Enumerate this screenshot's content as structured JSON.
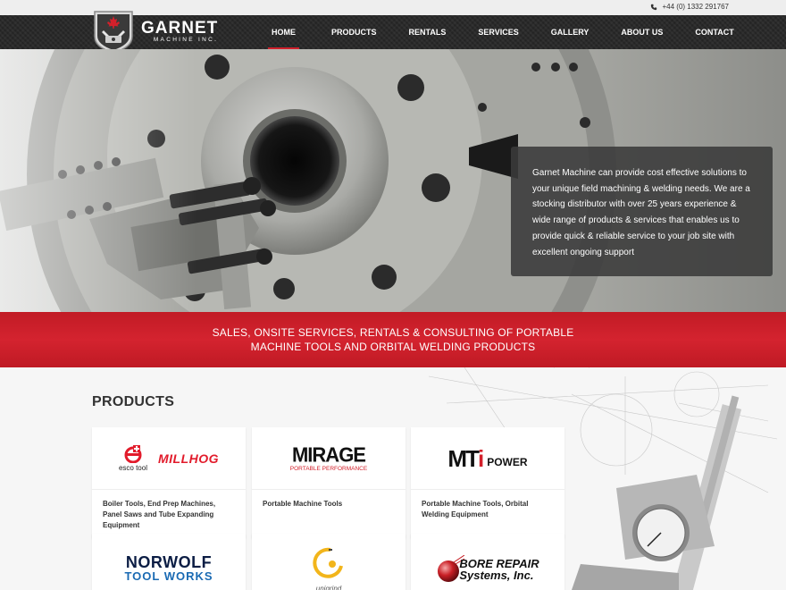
{
  "topbar": {
    "phone": "+44 (0) 1332 291767",
    "phone_icon": "phone-icon"
  },
  "brand": {
    "name": "GARNET",
    "sub": "MACHINE INC."
  },
  "nav": {
    "items": [
      {
        "label": "HOME",
        "active": true
      },
      {
        "label": "PRODUCTS"
      },
      {
        "label": "RENTALS"
      },
      {
        "label": "SERVICES"
      },
      {
        "label": "GALLERY"
      },
      {
        "label": "ABOUT US"
      },
      {
        "label": "CONTACT"
      }
    ]
  },
  "hero": {
    "text": "Garnet Machine can provide cost effective solutions to your unique field machining & welding needs. We are a stocking distributor with over 25 years experience & wide range of products & services that enables us to provide quick & reliable service to your job site with excellent ongoing support"
  },
  "band": {
    "text": "SALES, ONSITE SERVICES, RENTALS & CONSULTING OF PORTABLE MACHINE TOOLS AND ORBITAL WELDING PRODUCTS"
  },
  "products": {
    "title": "PRODUCTS",
    "cards": [
      {
        "logo": {
          "brand_a": "esco tool",
          "brand_b": "MILLHOG"
        },
        "desc": "Boiler Tools, End Prep Machines, Panel Saws and Tube Expanding Equipment"
      },
      {
        "logo": {
          "brand": "MIRAGE",
          "tagline": "PORTABLE PERFORMANCE"
        },
        "desc": "Portable Machine Tools"
      },
      {
        "logo": {
          "brand_m": "M",
          "brand_t": "T",
          "brand_i": "i",
          "brand_power": "POWER"
        },
        "desc": "Portable Machine Tools, Orbital Welding Equipment"
      },
      {
        "logo": {
          "line1": "NORWOLF",
          "line2": "TOOL WORKS"
        }
      },
      {
        "logo": {
          "brand": "unigrind"
        }
      },
      {
        "logo": {
          "line1": "BORE REPAIR",
          "line2": "Systems, Inc."
        }
      }
    ]
  },
  "colors": {
    "accent": "#d0202b",
    "nav_bg": "#2a2a2a",
    "band": "#c11b25"
  }
}
